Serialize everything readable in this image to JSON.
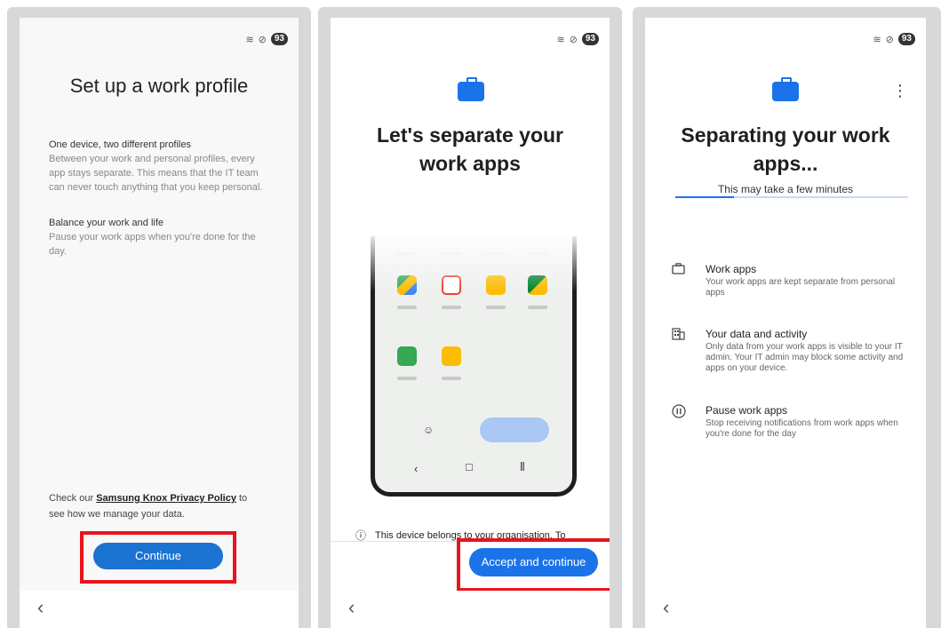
{
  "status": {
    "battery": "93"
  },
  "screen1": {
    "title": "Set up a work profile",
    "section1_heading": "One device, two different profiles",
    "section1_body": "Between your work and personal profiles, every app stays separate. This means that the IT team can never touch anything that you keep personal.",
    "section2_heading": "Balance your work and life",
    "section2_body": "Pause your work apps when you're done for the day.",
    "policy_prefix": "Check our ",
    "policy_link": "Samsung Knox Privacy Policy",
    "policy_suffix": " to see how we manage your data.",
    "continue_label": "Continue"
  },
  "screen2": {
    "title": "Let's separate your work apps",
    "info_text": "This device belongs to your organisation. To",
    "accept_label": "Accept and continue",
    "nav_back": "‹",
    "nav_home": "□",
    "nav_recents": "⦀"
  },
  "screen3": {
    "title": "Separating your work apps...",
    "subtitle": "This may take a few minutes",
    "progress": 0.25,
    "items": [
      {
        "icon": "briefcase-outline-icon",
        "title": "Work apps",
        "desc": "Your work apps are kept separate from personal apps"
      },
      {
        "icon": "building-icon",
        "title": "Your data and activity",
        "desc": "Only data from your work apps is visible to your IT admin. Your IT admin may block some activity and apps on your device."
      },
      {
        "icon": "pause-circle-icon",
        "title": "Pause work apps",
        "desc": "Stop receiving notifications from work apps when you're done for the day"
      }
    ]
  },
  "colors": {
    "primary": "#1a73e8",
    "highlight": "#e8141c",
    "frame": "#d8d8d8"
  }
}
